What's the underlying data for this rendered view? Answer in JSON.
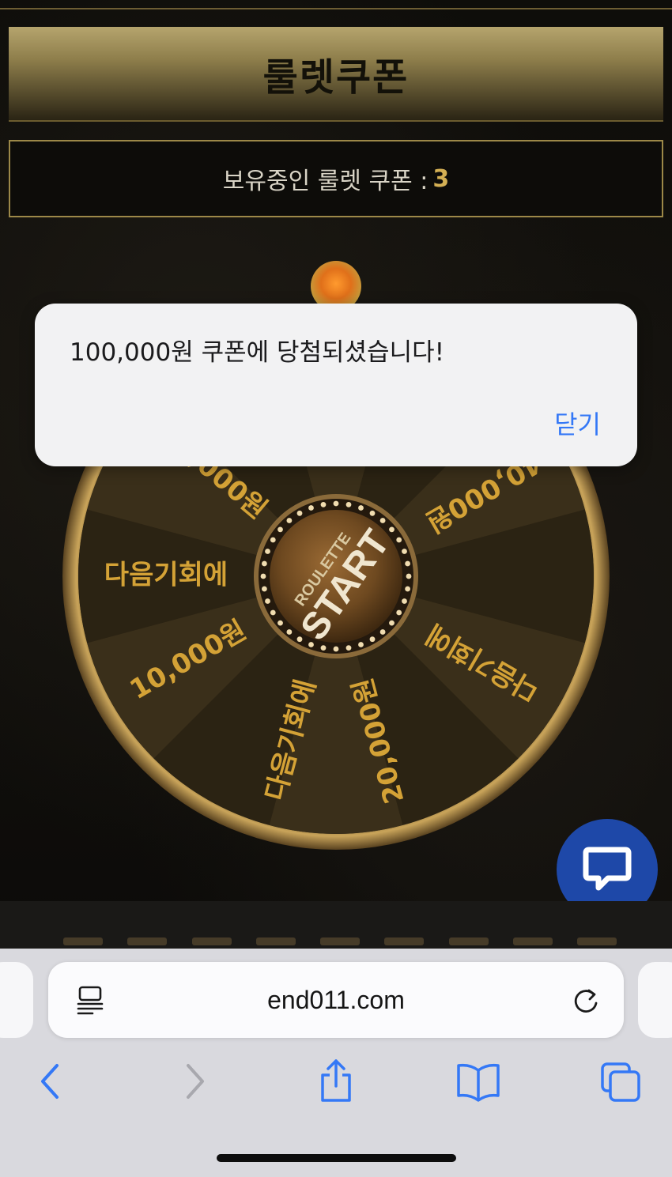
{
  "page": {
    "title": "룰렛쿠폰",
    "coupon_label": "보유중인 룰렛 쿠폰 : ",
    "coupon_count": "3"
  },
  "wheel": {
    "center_top": "ROULETTE",
    "center_main": "START",
    "segments": [
      "40,000원",
      "다음기회에",
      "20,000원",
      "다음기회에",
      "10,000원",
      "다음기회에",
      "100,000원"
    ],
    "colors": {
      "gold": "#d4a236",
      "rim": "#a88547"
    }
  },
  "dialog": {
    "message": "100,000원 쿠폰에 당첨되셨습니다!",
    "close_label": "닫기"
  },
  "chat": {
    "icon": "chat-bubble-icon",
    "color": "#1e48a8"
  },
  "browser": {
    "url": "end011.com",
    "icons": [
      "reader-icon",
      "reload-icon",
      "back-icon",
      "forward-icon",
      "share-icon",
      "bookmarks-icon",
      "tabs-icon"
    ],
    "accent": "#3478f6"
  }
}
